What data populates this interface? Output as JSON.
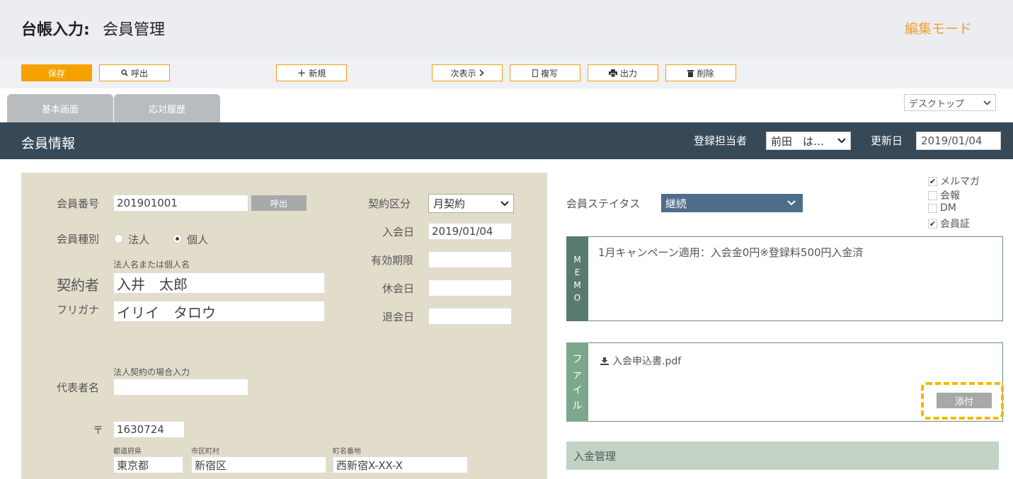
{
  "header": {
    "title_strong": "台帳入力:",
    "title_sub": "会員管理",
    "mode": "編集モード"
  },
  "toolbar": {
    "save": "保存",
    "call": "呼出",
    "new": "新規",
    "next": "次表示",
    "copy": "複写",
    "output": "出力",
    "delete": "削除"
  },
  "tabs": [
    "基本画面",
    "応対履歴"
  ],
  "view_select": "デスクトップ",
  "section": {
    "title": "会員情報",
    "registrar_label": "登録担当者",
    "registrar_value": "前田　は…",
    "updated_label": "更新日",
    "updated_value": "2019/01/04"
  },
  "form": {
    "member_no_label": "会員番号",
    "member_no": "201901001",
    "call_button": "呼出",
    "member_type_label": "会員種別",
    "type_corp": "法人",
    "type_individual": "個人",
    "name_hint": "法人名または個人名",
    "contractor_label": "契約者",
    "contractor": "入井　太郎",
    "furigana_label": "フリガナ",
    "furigana": "イリイ　タロウ",
    "rep_hint": "法人契約の場合入力",
    "rep_label": "代表者名",
    "rep_value": "",
    "postal_mark": "〒",
    "postal": "1630724",
    "pref_label": "都道府県",
    "pref": "東京都",
    "city_label": "市区町村",
    "city": "新宿区",
    "town_label": "町名番地",
    "town": "西新宿X-XX-X",
    "contract_label": "契約区分",
    "contract_value": "月契約",
    "join_label": "入会日",
    "join_date": "2019/01/04",
    "expiry_label": "有効期限",
    "expiry": "",
    "suspend_label": "休会日",
    "suspend": "",
    "leave_label": "退会日",
    "leave": ""
  },
  "status": {
    "label": "会員ステイタス",
    "value": "継続",
    "checks": [
      {
        "label": "メルマガ",
        "checked": true
      },
      {
        "label": "会報",
        "checked": false
      },
      {
        "label": "DM",
        "checked": false
      },
      {
        "label": "会員証",
        "checked": true
      }
    ]
  },
  "memo": {
    "side": [
      "M",
      "E",
      "M",
      "O"
    ],
    "text": "1月キャンペーン適用：入会金0円※登録料500円入金済"
  },
  "file": {
    "side": [
      "フ",
      "ァ",
      "イ",
      "ル"
    ],
    "filename": "入会申込書.pdf",
    "attach": "添付"
  },
  "payment": {
    "title": "入金管理"
  }
}
